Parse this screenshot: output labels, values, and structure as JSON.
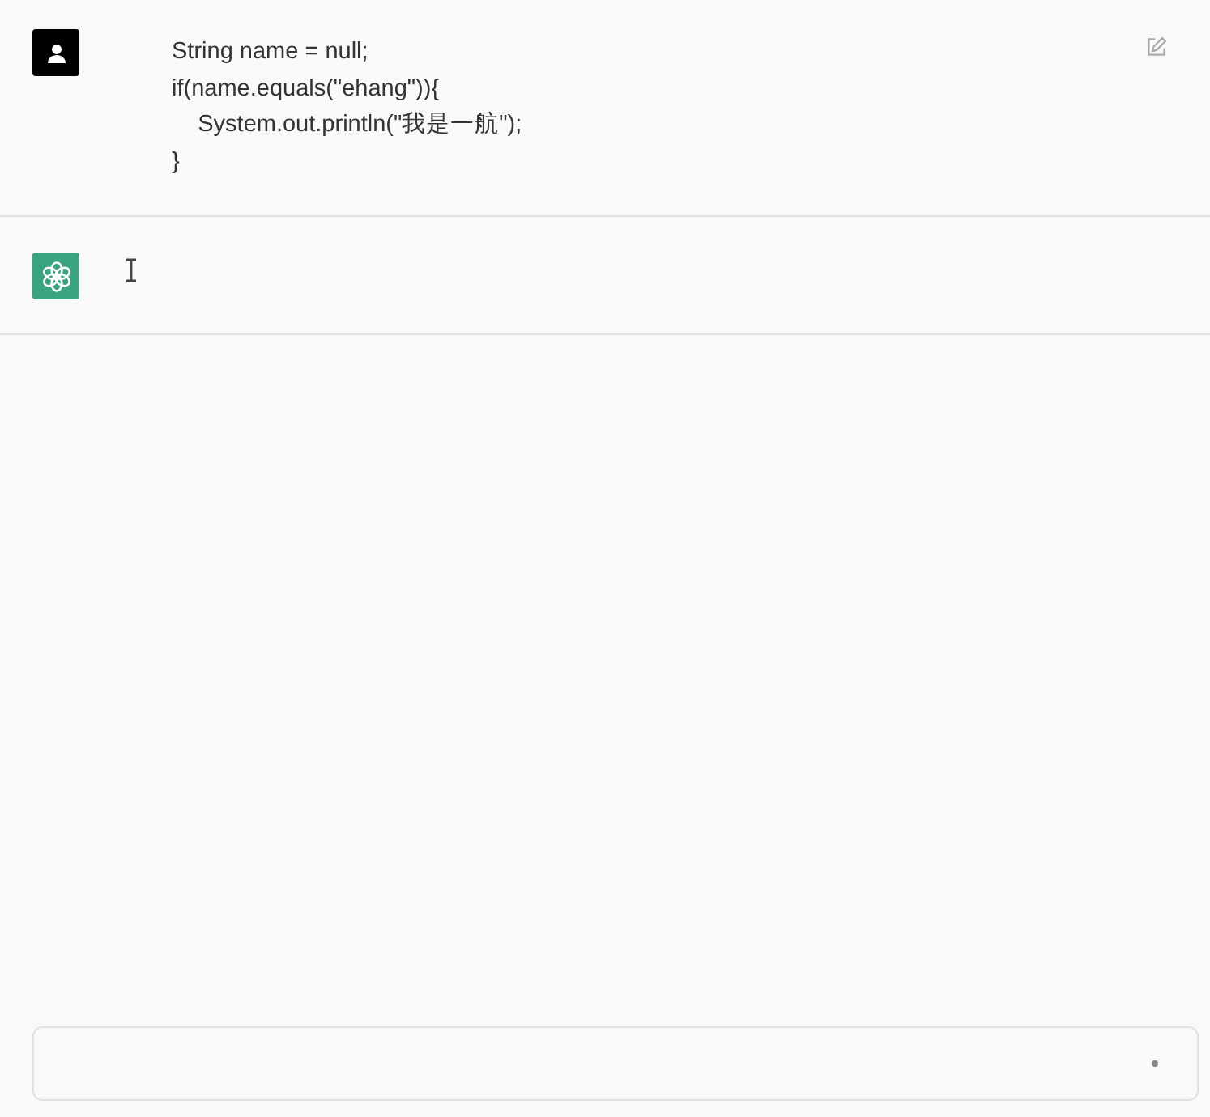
{
  "messages": [
    {
      "kind": "user",
      "lines": [
        "String name = null;",
        "if(name.equals(\"ehang\")){",
        "    System.out.println(\"我是一航\");",
        "}"
      ]
    },
    {
      "kind": "assistant"
    }
  ],
  "composer": {
    "busy": true
  }
}
